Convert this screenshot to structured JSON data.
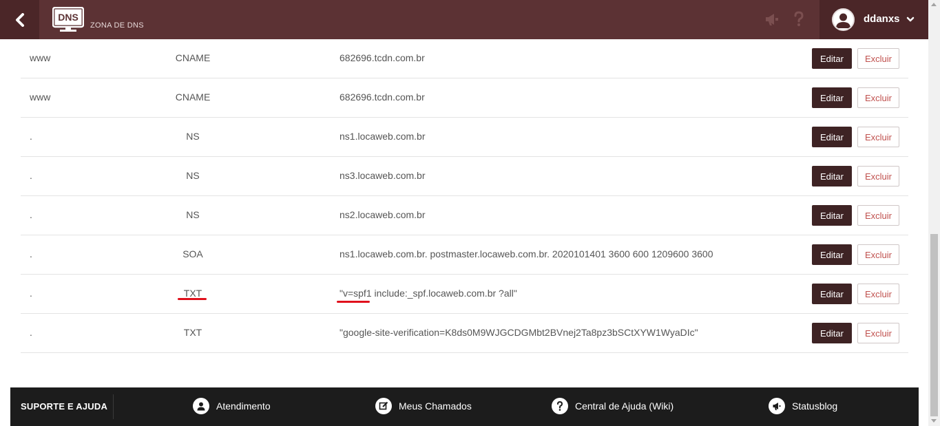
{
  "header": {
    "logo_text": "DNS",
    "title": "ZONA DE DNS",
    "user_name": "ddanxs"
  },
  "records": [
    {
      "name": "www",
      "type": "CNAME",
      "value": "682696.tcdn.com.br"
    },
    {
      "name": "www",
      "type": "CNAME",
      "value": "682696.tcdn.com.br"
    },
    {
      "name": ".",
      "type": "NS",
      "value": "ns1.locaweb.com.br"
    },
    {
      "name": ".",
      "type": "NS",
      "value": "ns3.locaweb.com.br"
    },
    {
      "name": ".",
      "type": "NS",
      "value": "ns2.locaweb.com.br"
    },
    {
      "name": ".",
      "type": "SOA",
      "value": "ns1.locaweb.com.br. postmaster.locaweb.com.br. 2020101401 3600 600 1209600 3600"
    },
    {
      "name": ".",
      "type": "TXT",
      "value": "\"v=spf1 include:_spf.locaweb.com.br ?all\""
    },
    {
      "name": ".",
      "type": "TXT",
      "value": "\"google-site-verification=K8ds0M9WJGCDGMbt2BVnej2Ta8pz3bSCtXYW1WyaDIc\""
    }
  ],
  "actions": {
    "edit_label": "Editar",
    "delete_label": "Excluir"
  },
  "footer": {
    "title": "SUPORTE E AJUDA",
    "links": [
      {
        "label": "Atendimento",
        "icon": "user-icon"
      },
      {
        "label": "Meus Chamados",
        "icon": "edit-icon"
      },
      {
        "label": "Central de Ajuda (Wiki)",
        "icon": "question-icon"
      },
      {
        "label": "Statusblog",
        "icon": "megaphone-icon"
      }
    ]
  },
  "colors": {
    "header_bg": "#5c3234",
    "header_dark": "#4b2628",
    "edit_button": "#3e2324",
    "delete_text": "#c0504d",
    "highlight_underline": "#e0101c",
    "footer_bg": "#1c1c1c"
  }
}
